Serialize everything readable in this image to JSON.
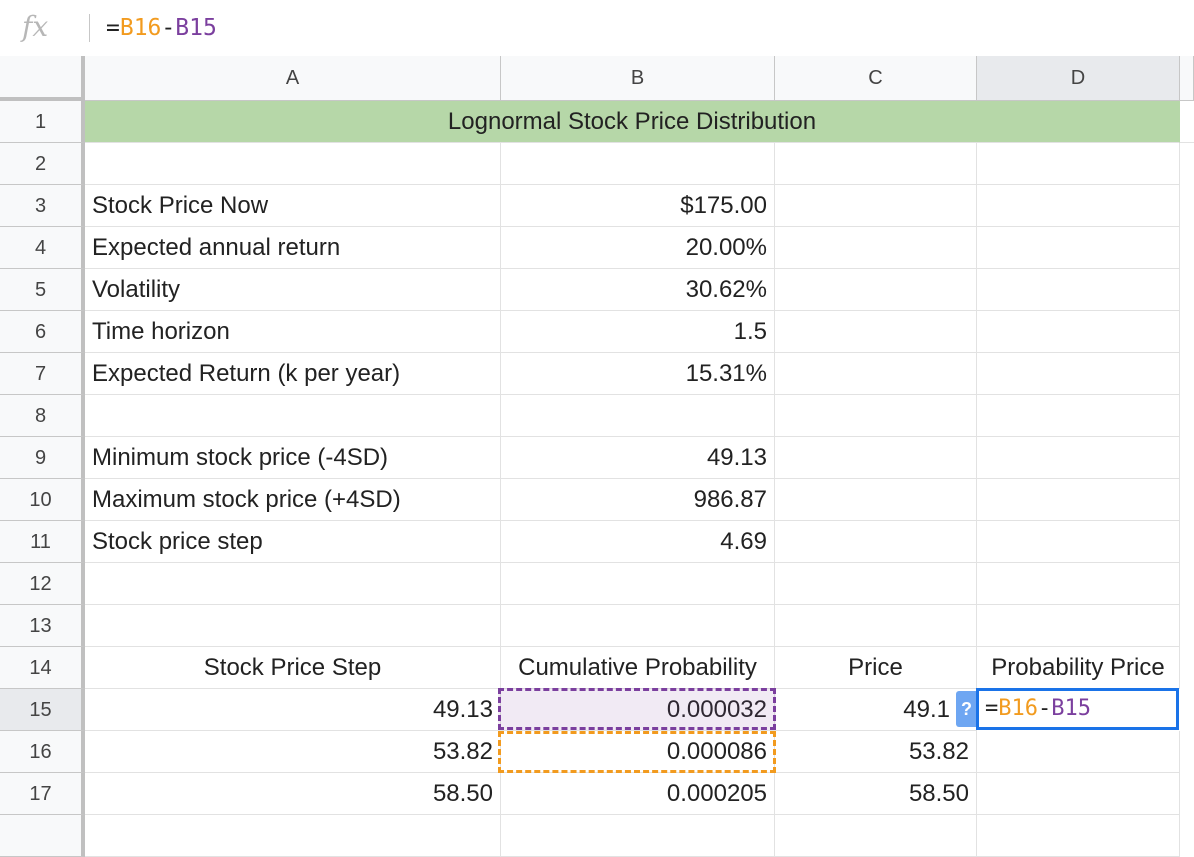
{
  "formula_bar": {
    "icon": "fx-icon",
    "eq": "=",
    "ref1": "B16",
    "op": "-",
    "ref2": "B15"
  },
  "columns": [
    "A",
    "B",
    "C",
    "D"
  ],
  "rows": [
    "1",
    "2",
    "3",
    "4",
    "5",
    "6",
    "7",
    "8",
    "9",
    "10",
    "11",
    "12",
    "13",
    "14",
    "15",
    "16",
    "17"
  ],
  "title": "Lognormal Stock Price Distribution",
  "params": {
    "stock_price_now": {
      "label": "Stock Price Now",
      "value": "$175.00"
    },
    "expected_annual_return": {
      "label": "Expected annual return",
      "value": "20.00%"
    },
    "volatility": {
      "label": "Volatility",
      "value": "30.62%"
    },
    "time_horizon": {
      "label": "Time horizon",
      "value": "1.5"
    },
    "expected_return_k": {
      "label": "Expected Return (k per year)",
      "value": "15.31%"
    },
    "min_price": {
      "label": "Minimum stock price (-4SD)",
      "value": "49.13"
    },
    "max_price": {
      "label": "Maximum stock price (+4SD)",
      "value": "986.87"
    },
    "price_step": {
      "label": "Stock price step",
      "value": "4.69"
    }
  },
  "table_headers": {
    "a": "Stock Price Step",
    "b": "Cumulative Probability",
    "c": "Price",
    "d": "Probability Price"
  },
  "table_rows": [
    {
      "a": "49.13",
      "b": "0.000032",
      "c": "49.1"
    },
    {
      "a": "53.82",
      "b": "0.000086",
      "c": "53.82"
    },
    {
      "a": "58.50",
      "b": "0.000205",
      "c": "58.50"
    }
  ],
  "active_cell": {
    "name": "D15",
    "eq": "=",
    "ref1": "B16",
    "op": "-",
    "ref2": "B15",
    "help_badge": "?"
  },
  "colors": {
    "title_fill": "#b6d7a8",
    "ref_orange": "#f29b1f",
    "ref_purple": "#7b3f9e",
    "active_border": "#1a73e8"
  }
}
